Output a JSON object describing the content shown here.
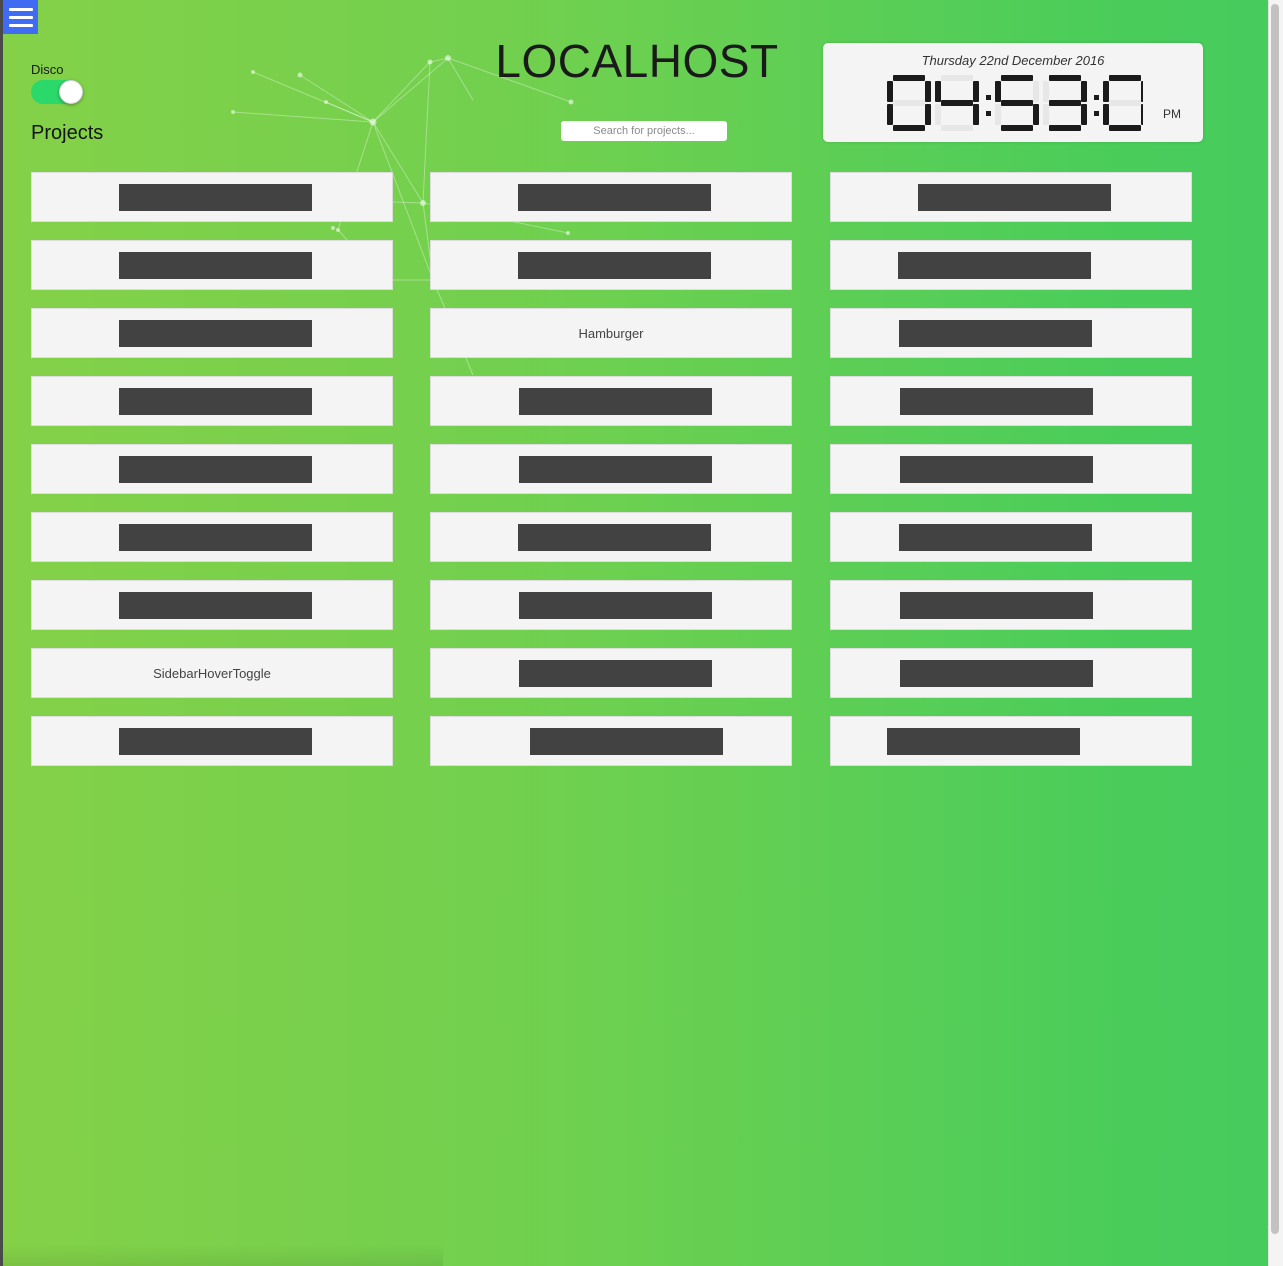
{
  "header": {
    "site_title": "LOCALHOST",
    "search_placeholder": "Search for projects..."
  },
  "sidebar_toggle": {
    "icon": "hamburger-menu-icon",
    "color": "#3f6cf2"
  },
  "disco": {
    "label": "Disco",
    "enabled": true,
    "on_color": "#2bd86a"
  },
  "projects_heading": "Projects",
  "clock": {
    "date": "Thursday 22nd December 2016",
    "time": "04:53:08",
    "ampm": "PM"
  },
  "background": {
    "gradient_start": "#84d148",
    "gradient_end": "#46cb5c"
  },
  "projects": [
    {
      "name": "",
      "redacted": true
    },
    {
      "name": "",
      "redacted": true
    },
    {
      "name": "",
      "redacted": true
    },
    {
      "name": "",
      "redacted": true
    },
    {
      "name": "",
      "redacted": true
    },
    {
      "name": "",
      "redacted": true
    },
    {
      "name": "",
      "redacted": true
    },
    {
      "name": "Hamburger",
      "redacted": false
    },
    {
      "name": "",
      "redacted": true
    },
    {
      "name": "",
      "redacted": true
    },
    {
      "name": "",
      "redacted": true
    },
    {
      "name": "",
      "redacted": true
    },
    {
      "name": "",
      "redacted": true
    },
    {
      "name": "",
      "redacted": true
    },
    {
      "name": "",
      "redacted": true
    },
    {
      "name": "",
      "redacted": true
    },
    {
      "name": "",
      "redacted": true
    },
    {
      "name": "",
      "redacted": true
    },
    {
      "name": "",
      "redacted": true
    },
    {
      "name": "",
      "redacted": true
    },
    {
      "name": "",
      "redacted": true
    },
    {
      "name": "SidebarHoverToggle",
      "redacted": false
    },
    {
      "name": "",
      "redacted": true
    },
    {
      "name": "",
      "redacted": true
    },
    {
      "name": "",
      "redacted": true
    },
    {
      "name": "",
      "redacted": true
    },
    {
      "name": "",
      "redacted": true
    }
  ]
}
